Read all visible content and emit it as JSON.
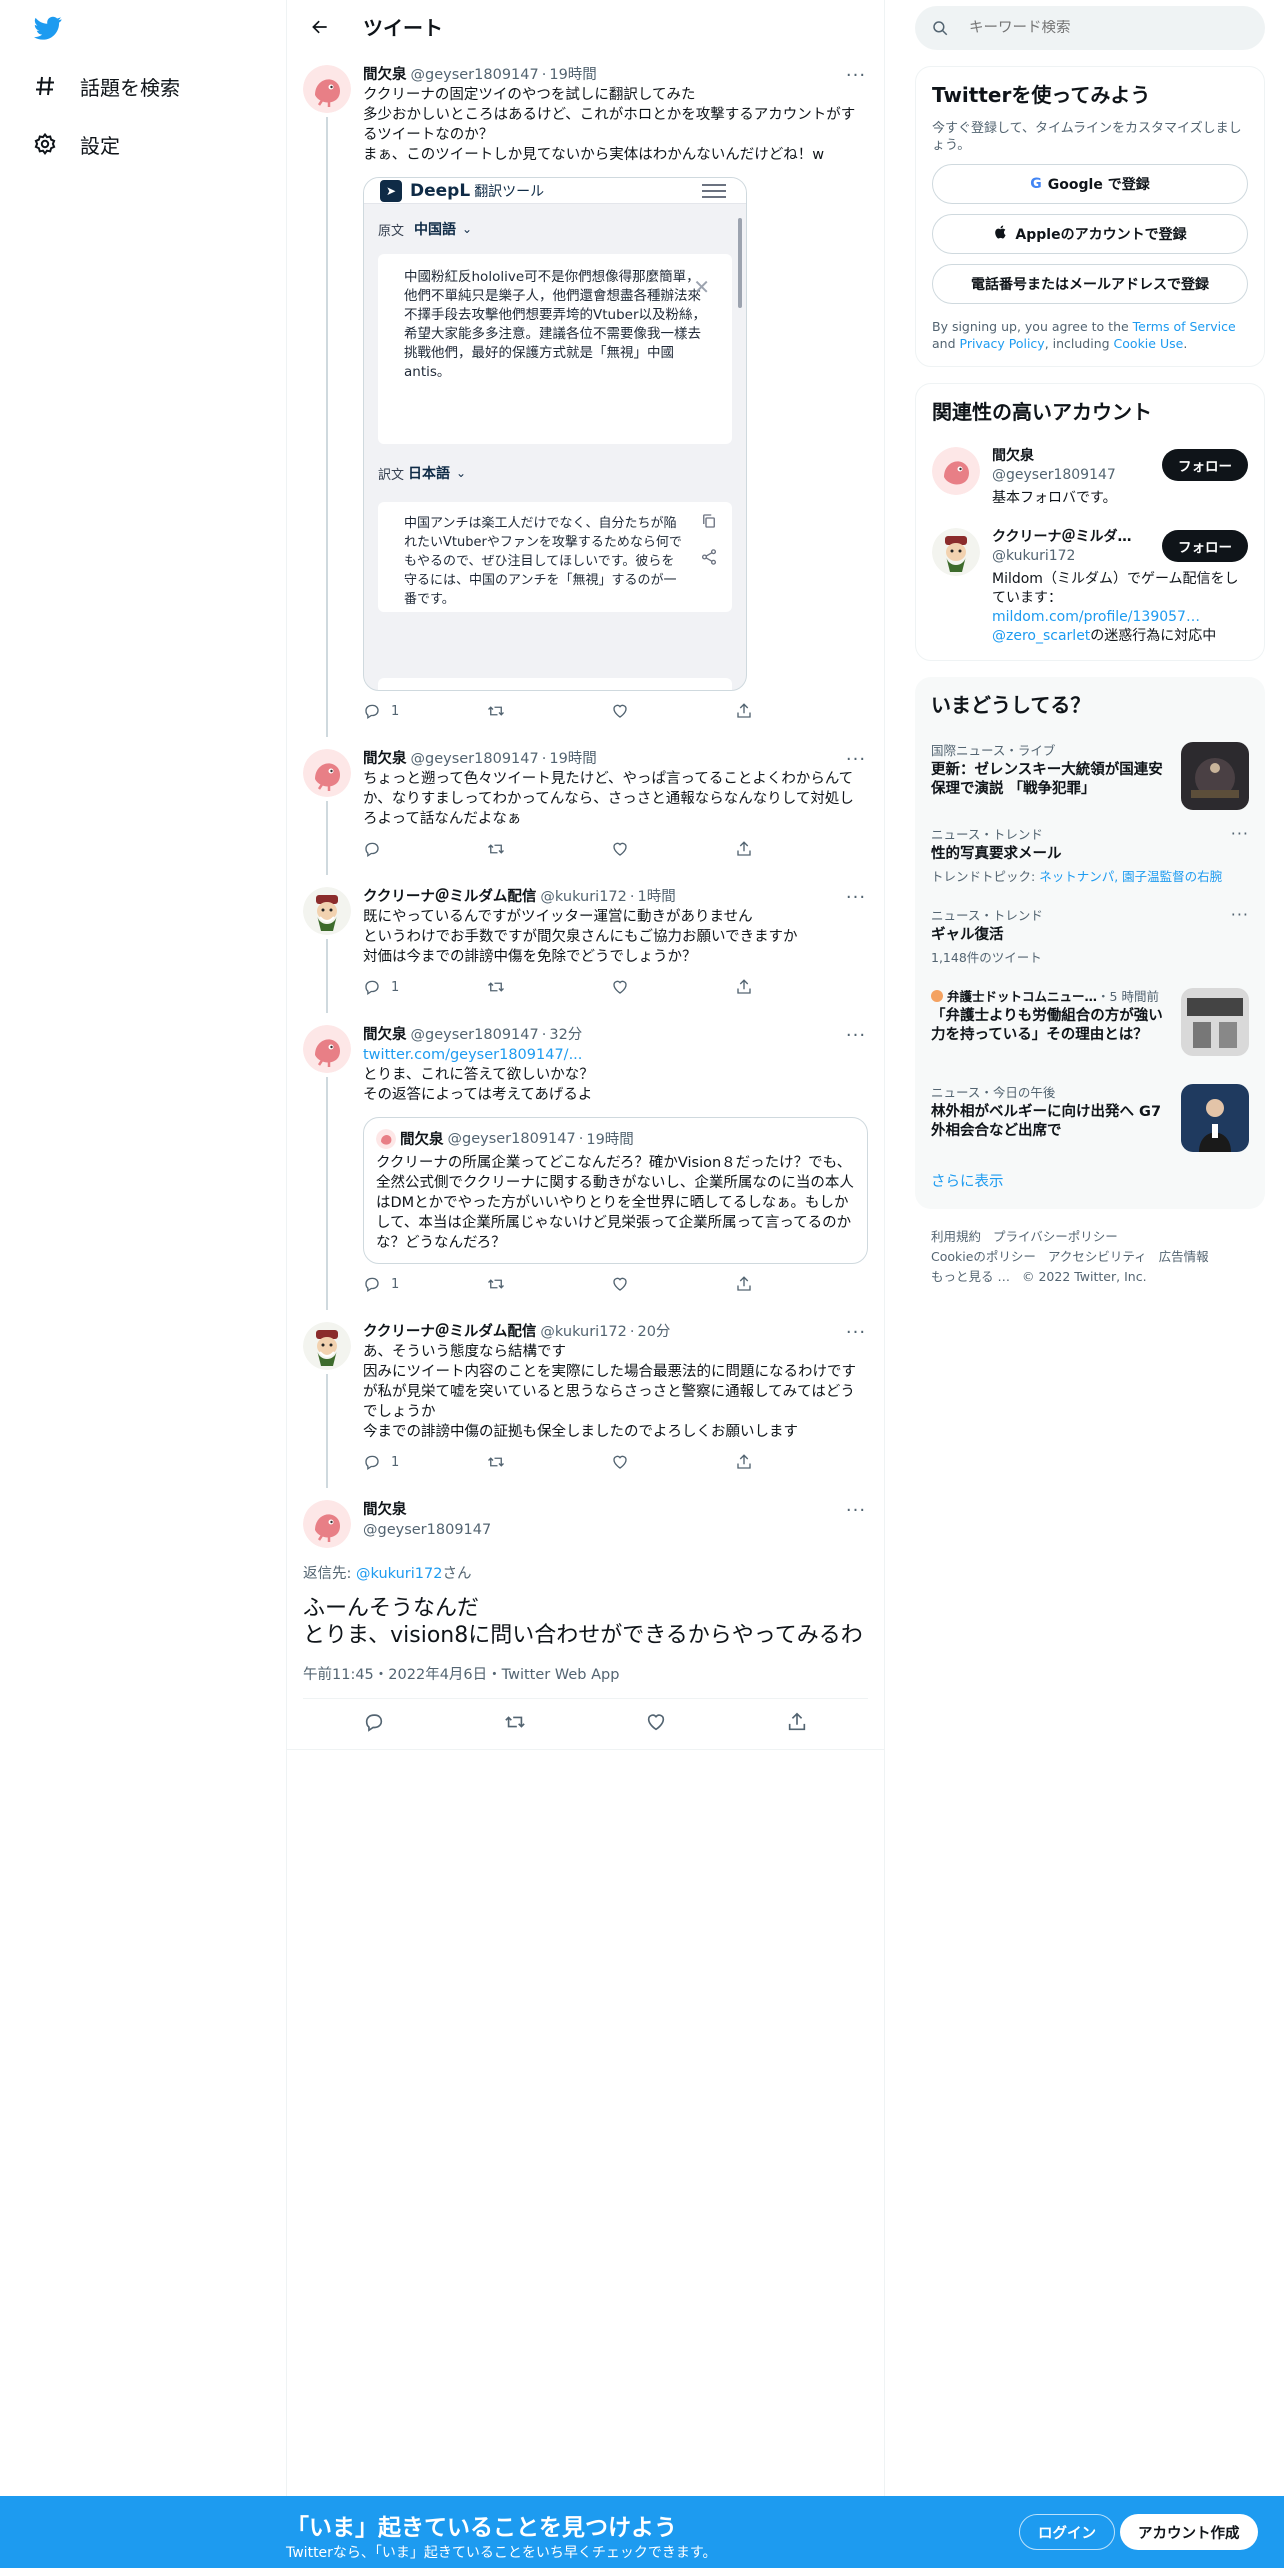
{
  "nav": {
    "explore_label": "話題を検索",
    "settings_label": "設定"
  },
  "header": {
    "title": "ツイート"
  },
  "tweets": [
    {
      "name": "間欠泉",
      "handle": "@geyser1809147",
      "time": "19時間",
      "text": "ククリーナの固定ツイのやつを試しに翻訳してみた\n多少おかしいところはあるけど、これがホロとかを攻撃するアカウントがするツイートなのか？\nまぁ、このツイートしか見てないから実体はわかんないんだけどね！w",
      "reply_count": "1",
      "media": {
        "brand": "DeepL",
        "brand_sub": "翻訳ツール",
        "source_label": "原文",
        "source_lang": "中国語",
        "source_text": "中國粉紅反hololive可不是你們想像得那麼簡單，他們不單純只是樂子人，他們還會想盡各種辦法來不擇手段去攻擊他們想要弄垮的Vtuber以及粉絲，希望大家能多多注意。建議各位不需要像我一樣去挑戰他們，最好的保護方式就是「無視」中國antis。",
        "target_label": "訳文",
        "target_lang": "日本語",
        "target_text": "中国アンチは楽工人だけでなく、自分たちが陥れたいVtuberやファンを攻撃するためなら何でもやるので、ぜひ注目してほしいです。彼らを守るには、中国のアンチを「無視」するのが一番です。"
      }
    },
    {
      "name": "間欠泉",
      "handle": "@geyser1809147",
      "time": "19時間",
      "text": "ちょっと遡って色々ツイート見たけど、やっぱ言ってることよくわからんてか、なりすましってわかってんなら、さっさと通報ならなんなりして対処しろよって話なんだよなぁ",
      "reply_count": ""
    },
    {
      "name": "ククリーナ＠ミルダム配信",
      "handle": "@kukuri172",
      "time": "1時間",
      "text": "既にやっているんですがツイッター運営に動きがありません\nというわけでお手数ですが間欠泉さんにもご協力お願いできますか\n対価は今までの誹謗中傷を免除でどうでしょうか？",
      "reply_count": "1"
    },
    {
      "name": "間欠泉",
      "handle": "@geyser1809147",
      "time": "32分",
      "link": "twitter.com/geyser1809147/...",
      "text": "とりま、これに答えて欲しいかな？\nその返答によっては考えてあげるよ",
      "reply_count": "1",
      "quote": {
        "name": "間欠泉",
        "handle": "@geyser1809147",
        "time": "19時間",
        "text": "ククリーナの所属企業ってどこなんだろ？確かVision８だったけ？でも、全然公式側でククリーナに関する動きがないし、企業所属なのに当の本人はDMとかでやった方がいいやりとりを全世界に晒してるしなぁ。もしかして、本当は企業所属じゃないけど見栄張って企業所属って言ってるのかな？どうなんだろ？"
      }
    },
    {
      "name": "ククリーナ＠ミルダム配信",
      "handle": "@kukuri172",
      "time": "20分",
      "text": "あ、そういう態度なら結構です\n因みにツイート内容のことを実際にした場合最悪法的に問題になるわけですが私が見栄て嘘を突いていると思うならさっさと警察に通報してみてはどうでしょうか\n今までの誹謗中傷の証拠も保全しましたのでよろしくお願いします",
      "reply_count": "1"
    }
  ],
  "focused": {
    "name": "間欠泉",
    "handle": "@geyser1809147",
    "reply_prefix": "返信先: ",
    "reply_to": "@kukuri172",
    "reply_suffix": "さん",
    "text": "ふーんそうなんだ\nとりま、vision8に問い合わせができるからやってみるわ",
    "meta": "午前11:45・2022年4月6日・Twitter Web App"
  },
  "search": {
    "placeholder": "キーワード検索"
  },
  "signup_card": {
    "title": "Twitterを使ってみよう",
    "subtitle": "今すぐ登録して、タイムラインをカスタマイズしましょう。",
    "google": "Google で登録",
    "apple": "Appleのアカウントで登録",
    "phone": "電話番号またはメールアドレスで登録",
    "legal_1": "By signing up, you agree to the ",
    "terms": "Terms of Service",
    "legal_2": " and ",
    "privacy": "Privacy Policy",
    "legal_3": ", including ",
    "cookie": "Cookie Use",
    "legal_4": "."
  },
  "related": {
    "title": "関連性の高いアカウント",
    "follow_label": "フォロー",
    "accounts": [
      {
        "name": "間欠泉",
        "handle": "@geyser1809147",
        "bio": "基本フォロバです。"
      },
      {
        "name": "ククリーナ＠ミルダ…",
        "handle": "@kukuri172",
        "bio": "Mildom（ミルダム）でゲーム配信をしています：",
        "bio_link": "mildom.com/profile/139057…",
        "bio_mention": "@zero_scarlet",
        "bio_tail": "の迷惑行為に対応中"
      }
    ]
  },
  "trends": {
    "title": "いまどうしてる？",
    "items": [
      {
        "meta": "国際ニュース・ライブ",
        "title": "更新：ゼレンスキー大統領が国連安保理で演説 「戦争犯罪」"
      },
      {
        "meta": "ニュース・トレンド",
        "title": "性的写真要求メール",
        "sub_prefix": "トレンドトピック: ",
        "sub_links": "ネットナンパ, 園子温監督の右腕"
      },
      {
        "meta": "ニュース・トレンド",
        "title": "ギャル復活",
        "sub": "1,148件のツイート"
      },
      {
        "meta_source": "弁護士ドットコムニュー…",
        "meta_time": "・5 時間前",
        "title": "「弁護士よりも労働組合の方が強い力を持っている」その理由とは？"
      },
      {
        "meta": "ニュース・今日の午後",
        "title": "林外相がベルギーに向け出発へ G7外相会合など出席で"
      }
    ],
    "show_more": "さらに表示"
  },
  "footer": {
    "links": [
      "利用規約",
      "プライバシーポリシー",
      "Cookieのポリシー",
      "アクセシビリティ",
      "広告情報",
      "もっと見る …"
    ],
    "copyright": "© 2022 Twitter, Inc."
  },
  "banner": {
    "title": "「いま」起きていることを見つけよう",
    "subtitle": "Twitterなら、「いま」起きていることをいち早くチェックできます。",
    "login": "ログイン",
    "signup": "アカウント作成"
  },
  "colors": {
    "accent": "#1d9bf0",
    "text": "#0f1419",
    "muted": "#536471"
  }
}
